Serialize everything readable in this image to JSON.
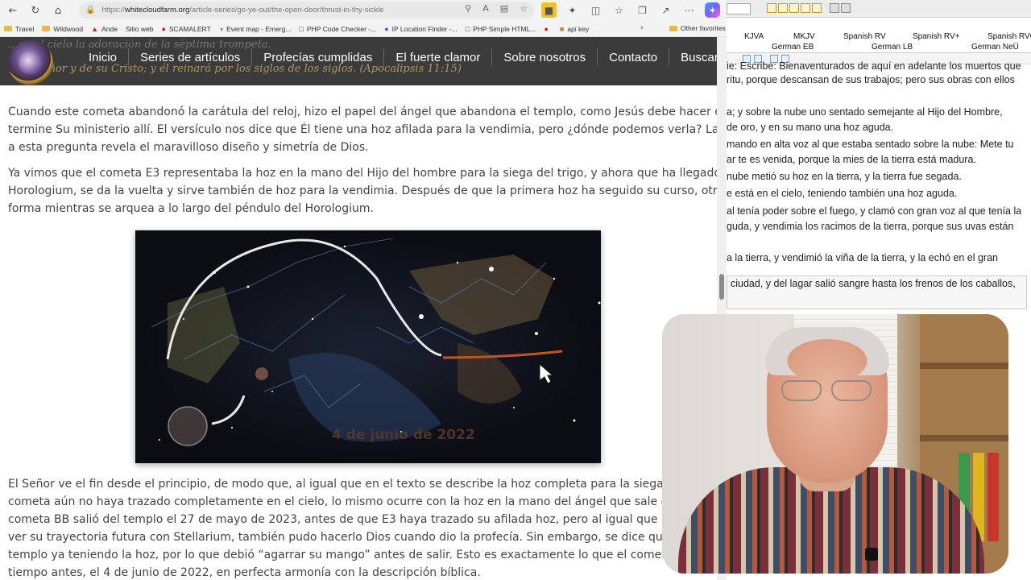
{
  "browser": {
    "url_prefix": "https://",
    "url_host": "whitecloudfarm.org",
    "url_path": "/article-series/go-ye-out/the-open-door/thrust-in-thy-sickle",
    "bookmarks": [
      "Travel",
      "Wildwood",
      "Ande",
      "Sitio web",
      "SCAMALERT",
      "Event map - Emerg...",
      "PHP Code Checker -...",
      "IP Location Finder -...",
      "PHP Simple HTML...",
      "api key"
    ],
    "other_favorites": "Other favorites"
  },
  "site": {
    "header_quote_1": "...en el cielo la adoración de la séptima trompeta.",
    "header_quote_2": "Señor y de su Cristo; y él reinará por los siglos de los siglos. (Apocalipsis 11:15)",
    "menu": [
      "Inicio",
      "Series de artículos",
      "Profecías cumplidas",
      "El fuerte clamor",
      "Sobre nosotros",
      "Contacto",
      "Buscar"
    ]
  },
  "article": {
    "p1": [
      "Cuando este cometa abandonó la carátula del reloj, hizo el papel del ángel que abandona el templo, como Jesús debe hacer cuando",
      "termine Su ministerio allí. El versículo nos dice que Él tiene una hoz afilada para la vendimia, pero ¿dónde podemos verla? La respuesta",
      "a esta pregunta revela el maravilloso diseño y simetría de Dios."
    ],
    "p2": [
      "Ya vimos que el cometa E3 representaba la hoz en la mano del Hijo del hombre para la siega del trigo, y ahora que ha llegado a",
      "Horologium, se da la vuelta y sirve también de hoz para la vendimia. Después de que la primera hoz ha seguido su curso, otra hoz toma",
      "forma mientras se arquea a lo largo del péndulo del Horologium."
    ],
    "figure_label": "4 de junio de 2022",
    "p3": [
      "El Señor ve el fin desde el principio, de modo que, al igual que en el texto se describe la hoz completa para la siega del trigo",
      "cometa aún no haya trazado completamente en el cielo, lo mismo ocurre con la hoz en la mano del ángel que sale del",
      "cometa BB salió del templo el 27 de mayo de 2023, antes de que E3 haya trazado su afilada hoz, pero al igual que nosotros",
      "ver su trayectoria futura con Stellarium, también pudo hacerlo Dios cuando dio la profecía. Sin embargo, se dice que",
      "templo ya teniendo la hoz, por lo que debió “agarrar su mango” antes de salir. Esto es exactamente lo que el cometa BB",
      "tiempo antes, el 4 de junio de 2022, en perfecta armonía con la descripción bíblica."
    ]
  },
  "bible_app": {
    "tabs_row1": [
      "KJVA",
      "MKJV",
      "Spanish RV",
      "Spanish RV+",
      "Spanish RVG"
    ],
    "tabs_row2": [
      "German EB",
      "German LB",
      "German NeÜ"
    ],
    "verses": [
      "ie: Escribe: Bienaventurados de aquí en adelante los muertos que",
      "ritu, porque descansan de sus trabajos; pero sus obras con ellos",
      "a; y sobre la nube uno sentado semejante al Hijo del Hombre,",
      "de oro, y en su mano una hoz aguda.",
      "mando en alta voz al que estaba sentado sobre la nube: Mete tu",
      "ar te es venida, porque la mies de la tierra está madura.",
      "nube metió su hoz en la tierra, y la tierra fue segada.",
      "e está en el cielo, teniendo también una hoz aguda.",
      "al tenía poder sobre el fuego, y clamó con gran voz al que tenía la",
      "guda, y vendimia los racimos de la tierra, porque sus uvas están",
      "a la tierra, y vendimió la viña de la tierra, y la echó en el gran",
      "ciudad, y del lagar salió sangre hasta los frenos de los caballos,"
    ]
  },
  "colors": {
    "site_header": "#3b3b3b",
    "gold_text": "#b09565",
    "comet_path": "#e8e8e8",
    "orange_path": "#c0561e"
  }
}
